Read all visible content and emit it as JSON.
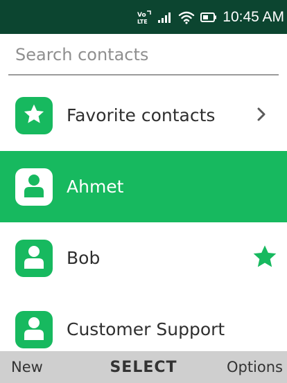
{
  "status_bar": {
    "network_label": "VoLTE",
    "time": "10:45 AM",
    "background": "#0c4530",
    "icons": [
      "volte-icon",
      "signal-icon",
      "wifi-icon",
      "battery-icon"
    ]
  },
  "search": {
    "placeholder": "Search contacts",
    "value": ""
  },
  "list": {
    "accent": "#17b95f",
    "items": [
      {
        "label": "Favorite contacts",
        "icon": "star-icon",
        "has_chevron": true,
        "selected": false,
        "favorite": false
      },
      {
        "label": "Ahmet",
        "icon": "person-icon",
        "has_chevron": false,
        "selected": true,
        "favorite": false
      },
      {
        "label": "Bob",
        "icon": "person-icon",
        "has_chevron": false,
        "selected": false,
        "favorite": true
      },
      {
        "label": "Customer Support",
        "icon": "person-icon",
        "has_chevron": false,
        "selected": false,
        "favorite": false
      }
    ]
  },
  "softkeys": {
    "left": "New",
    "center": "SELECT",
    "right": "Options"
  }
}
